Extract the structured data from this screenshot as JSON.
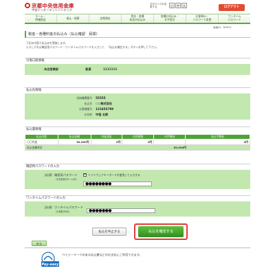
{
  "header": {
    "bank_name": "京都中央信用金庫",
    "service_name": "中信インターネットバンキング",
    "font_size_label": "文字サイズを変更する",
    "font_sizes": [
      "小",
      "中",
      "大"
    ],
    "logout_label": "ログアウト"
  },
  "nav": {
    "items": [
      "ホーム・\n明細照会",
      "振込・振替",
      "定期預金",
      "税金・各種\n料金の払込み",
      "各種お申込み・\nお手続き",
      "お客様ID・\nパスワード変更",
      "ワンタイム\nパスワード"
    ]
  },
  "screen_id": "画面ID：BHP03",
  "page": {
    "title": "税金・各種料金の払込み（払込確認　民間）",
    "intro_lines": [
      "下記の内容で払込みを実施します。",
      "よろしければ確認用パスワード・ワンタイムパスワードを入力して、「払込を確定する」ボタンを押して下さい。"
    ]
  },
  "source_account": {
    "heading": "引落口座情報",
    "branch": "本店営業部",
    "type": "普通",
    "number": "1111111"
  },
  "payee": {
    "heading": "払込先情報",
    "fields": [
      {
        "label": "収納機関番号",
        "value": "55555"
      },
      {
        "label": "払込先",
        "value": "○○株式会社"
      },
      {
        "label": "お客様番号",
        "value": "123456789"
      },
      {
        "label": "お名前",
        "value": "中信 太郎"
      }
    ]
  },
  "payment": {
    "heading": "払込書情報",
    "columns": [
      "払込内容",
      "払込金額",
      "内延滞金",
      "内消費税",
      "内手数料",
      "払込手数料"
    ],
    "rows": [
      [
        "〇〇代金",
        "50,000円",
        "0円",
        "0円",
        "",
        "0円"
      ]
    ],
    "total_label": "払込金額合計",
    "total_value": "50,000円"
  },
  "confirm_password": {
    "heading": "確認用パスワードの入力",
    "required": "［必須］",
    "label": "確認用パスワード",
    "sub": "（半角英数字6〜12桁）",
    "keyboard_label": "ソフトウェアキーボードを使用して入力する",
    "keyboard_checked": "✔",
    "value": "●●●●●●●●"
  },
  "onetime_password": {
    "heading": "ワンタイムパスワードの入力",
    "required": "［必須］",
    "label": "ワンタイムパスワード",
    "sub": "（半角数字6桁）",
    "value": "●●●●●●●"
  },
  "actions": {
    "cancel_label": "払込を中止する",
    "confirm_label": "払込を確定する",
    "back_label": "戻る"
  },
  "payeasy": {
    "logo_text": "Pay-easy",
    "note": "ペイジーマークのある払込書などのお支払にご利用できます。"
  },
  "colors": {
    "brand_red": "#c51d24",
    "accent_green": "#5aa83c",
    "panel_green": "#c2e8b0",
    "logout_orange": "#e24c2e",
    "highlight_red": "#e23a3a"
  }
}
